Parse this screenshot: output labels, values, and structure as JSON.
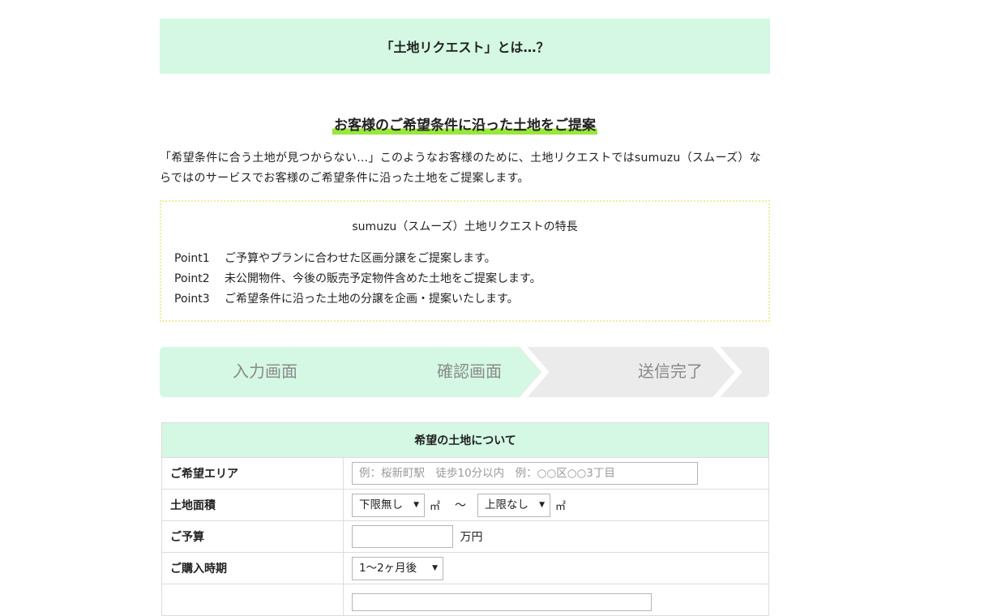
{
  "colors": {
    "mint": "#d4f8e3",
    "highlight_green": "#99e63c",
    "step_inactive": "#ebebeb",
    "features_border": "#f2ec9a"
  },
  "hero": {
    "title": "「土地リクエスト」とは…？"
  },
  "section": {
    "subtitle": "お客様のご希望条件に沿った土地をご提案",
    "intro": "「希望条件に合う土地が見つからない…」このようなお客様のために、土地リクエストではsumuzu（スムーズ）ならではのサービスでお客様のご希望条件に沿った土地をご提案します。"
  },
  "features": {
    "title": "sumuzu（スムーズ）土地リクエストの特長",
    "points": [
      {
        "label": "Point1",
        "text": "ご予算やプランに合わせた区画分譲をご提案します。"
      },
      {
        "label": "Point2",
        "text": "未公開物件、今後の販売予定物件含めた土地をご提案します。"
      },
      {
        "label": "Point3",
        "text": "ご希望条件に沿った土地の分譲を企画・提案いたします。"
      }
    ]
  },
  "steps": [
    {
      "label": "入力画面",
      "active": true
    },
    {
      "label": "確認画面",
      "active": false
    },
    {
      "label": "送信完了",
      "active": false
    }
  ],
  "form": {
    "caption": "希望の土地について",
    "area": {
      "label": "ご希望エリア",
      "value": "",
      "placeholder": "例：桜新町駅　徒歩10分以内　例：○○区○○3丁目"
    },
    "land_size": {
      "label": "土地面積",
      "min_selected": "下限無し",
      "max_selected": "上限なし",
      "unit": "㎡",
      "separator": "～"
    },
    "budget": {
      "label": "ご予算",
      "value": "",
      "unit": "万円"
    },
    "purchase_timing": {
      "label": "ご購入時期",
      "selected": "1～2ヶ月後"
    }
  }
}
